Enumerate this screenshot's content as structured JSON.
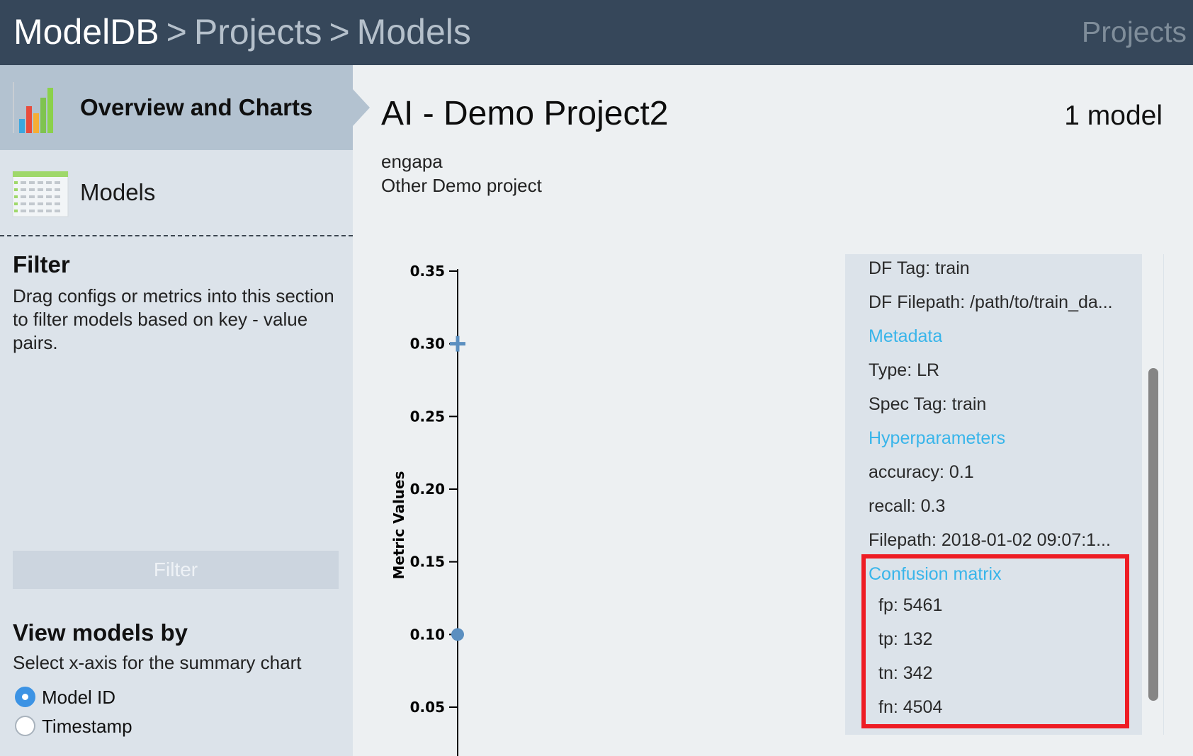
{
  "header": {
    "breadcrumbs": [
      "ModelDB",
      "Projects",
      "Models"
    ],
    "separator": ">",
    "right_link": "Projects"
  },
  "sidebar": {
    "nav": [
      {
        "label": "Overview and Charts",
        "icon": "bar-chart-icon",
        "active": true
      },
      {
        "label": "Models",
        "icon": "table-icon",
        "active": false
      }
    ],
    "filter": {
      "title": "Filter",
      "description": "Drag configs or metrics into this section to filter models based on key - value pairs.",
      "button_label": "Filter"
    },
    "view_by": {
      "title": "View models by",
      "description": "Select x-axis for the summary chart",
      "options": [
        {
          "label": "Model ID",
          "checked": true
        },
        {
          "label": "Timestamp",
          "checked": false
        }
      ]
    }
  },
  "project": {
    "title": "AI - Demo Project2",
    "model_count": "1 model",
    "owner": "engapa",
    "description": "Other Demo project"
  },
  "chart_data": {
    "type": "scatter",
    "ylabel": "Metric Values",
    "xlabel": "",
    "ylim": [
      0.05,
      0.35
    ],
    "yticks": [
      "0.35",
      "0.30",
      "0.25",
      "0.20",
      "0.15",
      "0.10",
      "0.05"
    ],
    "series": [
      {
        "marker": "plus",
        "values": [
          0.3
        ]
      },
      {
        "marker": "circle",
        "values": [
          0.1
        ]
      }
    ],
    "colors": {
      "marker": "#5b8fc0",
      "axis": "#000000"
    }
  },
  "details": {
    "items": [
      {
        "text": "DF Tag: train",
        "kind": "prop"
      },
      {
        "text": "DF Filepath: /path/to/train_da...",
        "kind": "prop"
      },
      {
        "text": "Metadata",
        "kind": "section"
      },
      {
        "text": "Type: LR",
        "kind": "prop"
      },
      {
        "text": "Spec Tag: train",
        "kind": "prop"
      },
      {
        "text": "Hyperparameters",
        "kind": "section"
      },
      {
        "text": "accuracy: 0.1",
        "kind": "prop"
      },
      {
        "text": "recall: 0.3",
        "kind": "prop"
      },
      {
        "text": "Filepath: 2018-01-02 09:07:1...",
        "kind": "prop"
      },
      {
        "text": "Confusion matrix",
        "kind": "section"
      },
      {
        "text": "fp: 5461",
        "kind": "sub"
      },
      {
        "text": "tp: 132",
        "kind": "sub"
      },
      {
        "text": "tn: 342",
        "kind": "sub"
      },
      {
        "text": "fn: 4504",
        "kind": "sub"
      }
    ],
    "highlight_color": "#ee1c24"
  },
  "colors": {
    "header_bg": "#36475a",
    "sidebar_bg": "#dce3ea",
    "active_nav_bg": "#b3c2d0",
    "link": "#39b5ea",
    "radio_checked": "#3c93e4"
  }
}
